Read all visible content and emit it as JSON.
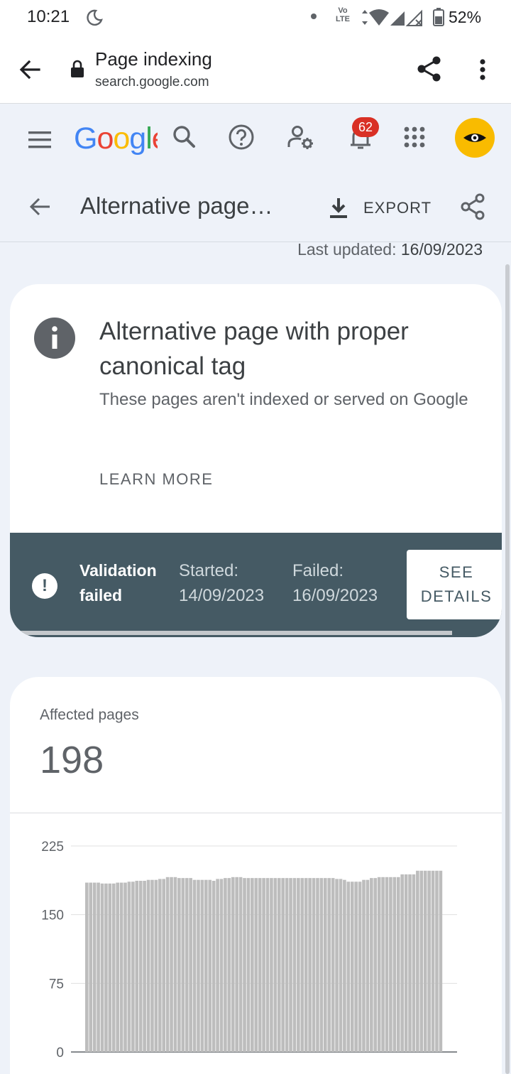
{
  "status_bar": {
    "time": "10:21",
    "network": "Vo LTE",
    "battery": "52%"
  },
  "browser": {
    "page_title": "Page indexing",
    "url": "search.google.com"
  },
  "header": {
    "logo_letters": [
      {
        "ch": "G",
        "color": "#4285f4"
      },
      {
        "ch": "o",
        "color": "#ea4335"
      },
      {
        "ch": "o",
        "color": "#fbbc05"
      },
      {
        "ch": "g",
        "color": "#4285f4"
      },
      {
        "ch": "l",
        "color": "#34a853"
      },
      {
        "ch": "e",
        "color": "#ea4335"
      }
    ],
    "notification_count": "62",
    "avatar_color": "#f9bb00"
  },
  "toolbar": {
    "title": "Alternative page…",
    "export_label": "EXPORT"
  },
  "last_updated": {
    "label": "Last updated:",
    "value": "16/09/2023"
  },
  "issue": {
    "title": "Alternative page with proper canonical tag",
    "subtitle": "These pages aren't indexed or served on Google",
    "learn_more": "LEARN MORE",
    "validation": {
      "status_line1": "Validation",
      "status_line2": "failed",
      "started_label": "Started:",
      "started_date": "14/09/2023",
      "failed_label": "Failed:",
      "failed_date": "16/09/2023",
      "see_details_line1": "SEE",
      "see_details_line2": "DETAILS"
    }
  },
  "affected": {
    "label": "Affected pages",
    "count": "198"
  },
  "chart_data": {
    "type": "bar",
    "ylim": [
      0,
      225
    ],
    "yticks": [
      0,
      75,
      150,
      225
    ],
    "bar_color": "#bdbdbd",
    "values": [
      185,
      185,
      185,
      185,
      184,
      184,
      184,
      184,
      185,
      185,
      185,
      186,
      186,
      187,
      187,
      187,
      188,
      188,
      188,
      189,
      189,
      191,
      191,
      191,
      190,
      190,
      190,
      190,
      188,
      188,
      188,
      188,
      188,
      187,
      189,
      189,
      190,
      190,
      191,
      191,
      191,
      190,
      190,
      190,
      190,
      190,
      190,
      190,
      190,
      190,
      190,
      190,
      190,
      190,
      190,
      190,
      190,
      190,
      190,
      190,
      190,
      190,
      190,
      190,
      190,
      189,
      189,
      188,
      186,
      186,
      186,
      186,
      188,
      188,
      190,
      190,
      191,
      191,
      191,
      191,
      191,
      191,
      194,
      194,
      194,
      194,
      198,
      198,
      198,
      198,
      198,
      198,
      198
    ]
  }
}
